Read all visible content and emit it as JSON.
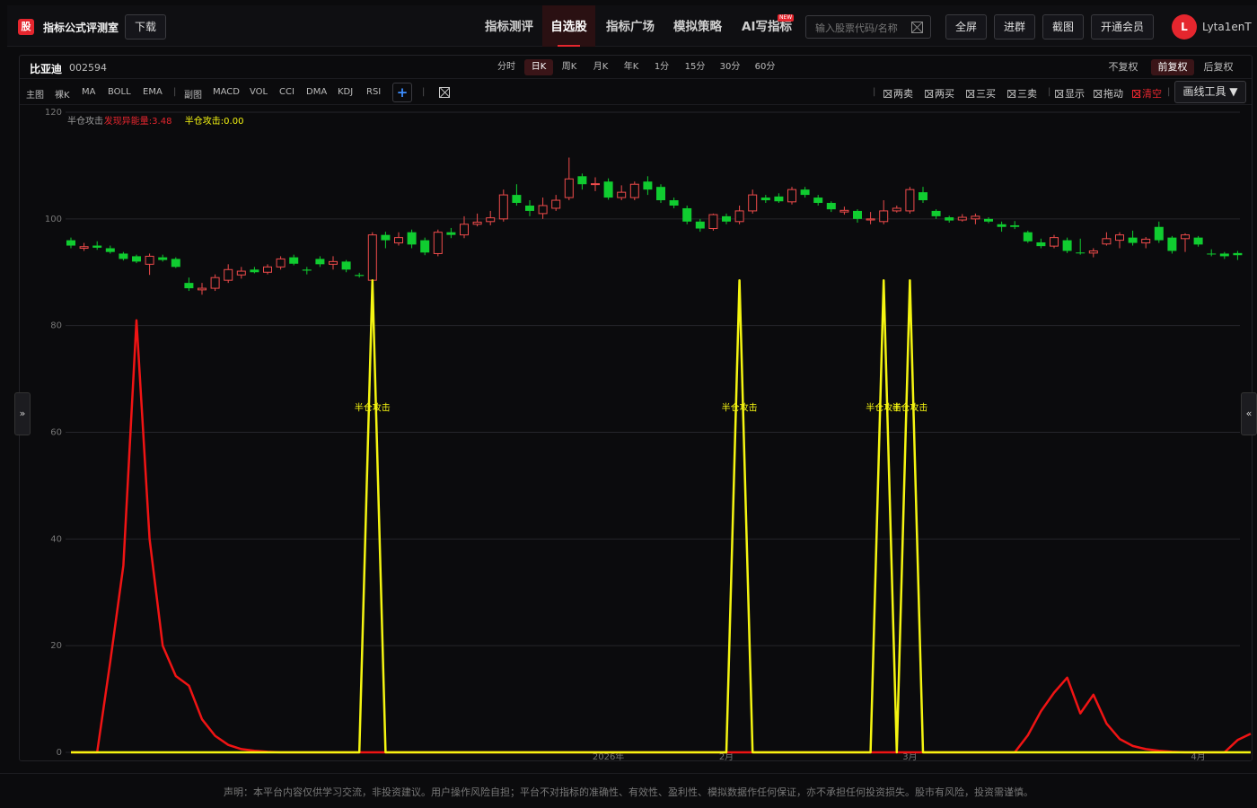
{
  "header": {
    "logo_text": "股",
    "brand": "指标公式评测室",
    "download": "下载",
    "nav": [
      "指标测评",
      "自选股",
      "指标广场",
      "模拟策略",
      "AI写指标"
    ],
    "nav_active": "自选股",
    "new_badge": "NEW",
    "search_placeholder": "输入股票代码/名称",
    "buttons": [
      "全屏",
      "进群",
      "截图",
      "开通会员"
    ],
    "avatar_letter": "L",
    "username": "Lyta1enT"
  },
  "stock": {
    "name": "比亚迪",
    "code": "002594"
  },
  "periods": [
    "分时",
    "日K",
    "周K",
    "月K",
    "年K",
    "1分",
    "15分",
    "30分",
    "60分"
  ],
  "period_active": "日K",
  "adjust": [
    "不复权",
    "前复权",
    "后复权"
  ],
  "adjust_active": "前复权",
  "main_indicators": [
    "主图",
    "裸K",
    "MA",
    "BOLL",
    "EMA"
  ],
  "sub_indicators": [
    "副图",
    "MACD",
    "VOL",
    "CCI",
    "DMA",
    "KDJ",
    "RSI"
  ],
  "add_label": "+",
  "tools": [
    "两卖",
    "两买",
    "三买",
    "三卖",
    "显示",
    "拖动",
    "清空"
  ],
  "draw_tool": "画线工具 ▼",
  "side_left": "»",
  "side_right": "«",
  "disclaimer": "声明：本平台内容仅供学习交流，非投资建议。用户操作风险自担；平台不对指标的准确性、有效性、盈利性、模拟数据作任何保证，亦不承担任何投资损失。股市有风险，投资需谨慎。",
  "chart_data": {
    "type": "candlestick",
    "y_ticks": [
      0,
      20,
      40,
      60,
      80,
      100,
      120
    ],
    "ylim": [
      0,
      120
    ],
    "x_labels": [
      "2026年",
      "2月",
      "3月",
      "4月"
    ],
    "legend": [
      {
        "text": "半仓攻击",
        "color": "#9a9a9a"
      },
      {
        "text": "发现异能量:3.48",
        "color": "#e5262e"
      },
      {
        "text": "半仓攻击:0.00",
        "color": "#f5f511"
      }
    ],
    "annotation_text": "半仓攻击",
    "colors": {
      "up": "#ef4b4b",
      "down": "#10cc30",
      "red_line": "#f01414",
      "yellow_line": "#f5f511"
    },
    "candles": [
      [
        96,
        95,
        96.5,
        94.5
      ],
      [
        94.5,
        94.8,
        95.5,
        94
      ],
      [
        95,
        94.6,
        95.8,
        94.2
      ],
      [
        94.5,
        93.8,
        95,
        93.5
      ],
      [
        93.5,
        92.5,
        93.8,
        92.2
      ],
      [
        93,
        92,
        93.3,
        91.7
      ],
      [
        91.5,
        93,
        93.5,
        89.5
      ],
      [
        92.8,
        92.3,
        93.3,
        92
      ],
      [
        92.5,
        91,
        92.8,
        90.8
      ],
      [
        88,
        87,
        89,
        86.5
      ],
      [
        86.7,
        87,
        88,
        85.8
      ],
      [
        87,
        89,
        89.6,
        86.5
      ],
      [
        88.5,
        90.5,
        91.5,
        88
      ],
      [
        89.5,
        90.2,
        91,
        88.8
      ],
      [
        90.5,
        90,
        91,
        89.8
      ],
      [
        90,
        91,
        91.5,
        89.6
      ],
      [
        91,
        92.5,
        93,
        90.5
      ],
      [
        92.8,
        91.6,
        93.3,
        91.3
      ],
      [
        90.5,
        90.3,
        91,
        89.6
      ],
      [
        92.5,
        91.5,
        93,
        91
      ],
      [
        91.5,
        92,
        93,
        90.5
      ],
      [
        92,
        90.5,
        92.3,
        90
      ],
      [
        89.5,
        89.3,
        89.9,
        89
      ],
      [
        88.5,
        97,
        97.5,
        88.3
      ],
      [
        97,
        96,
        97.6,
        94.5
      ],
      [
        95.5,
        96.5,
        97.5,
        95
      ],
      [
        97.5,
        95.2,
        98,
        94.5
      ],
      [
        96,
        93.7,
        96.5,
        93.2
      ],
      [
        93.5,
        97.5,
        98,
        93
      ],
      [
        97.5,
        97,
        98.3,
        96.4
      ],
      [
        97,
        99,
        100.5,
        96.4
      ],
      [
        99,
        99.4,
        101,
        98.6
      ],
      [
        99.5,
        100.2,
        101.5,
        98.8
      ],
      [
        100,
        104.5,
        105.5,
        99.5
      ],
      [
        104.5,
        103,
        106.5,
        102.5
      ],
      [
        102.5,
        101.5,
        103.5,
        100.5
      ],
      [
        101,
        102.5,
        104,
        100
      ],
      [
        102,
        103.5,
        104.5,
        101.5
      ],
      [
        104,
        107.5,
        111.5,
        103.5
      ],
      [
        108,
        106.5,
        108.5,
        105.5
      ],
      [
        106.5,
        106.6,
        107.8,
        105.2
      ],
      [
        107,
        104,
        107.6,
        103.6
      ],
      [
        104,
        105,
        106.3,
        103.5
      ],
      [
        104,
        106.5,
        107,
        103.5
      ],
      [
        107,
        105.5,
        108,
        104.5
      ],
      [
        106,
        103.5,
        106.5,
        103
      ],
      [
        103.5,
        102.5,
        104,
        102
      ],
      [
        102,
        99.5,
        102.5,
        99
      ],
      [
        99.5,
        98.2,
        100,
        97.6
      ],
      [
        98.2,
        100.8,
        101,
        97.8
      ],
      [
        100.5,
        99.5,
        101,
        99
      ],
      [
        99.5,
        101.5,
        102.5,
        99
      ],
      [
        101.5,
        104.5,
        105.5,
        101
      ],
      [
        104,
        103.5,
        104.5,
        103
      ],
      [
        104.2,
        103.3,
        104.8,
        103
      ],
      [
        103.2,
        105.5,
        106,
        102.7
      ],
      [
        105.5,
        104.5,
        106,
        104
      ],
      [
        104,
        103,
        104.5,
        102.5
      ],
      [
        103,
        101.8,
        103.3,
        101.3
      ],
      [
        101.3,
        101.6,
        102.3,
        100.8
      ],
      [
        101.5,
        100,
        101.8,
        99.3
      ],
      [
        99.8,
        100,
        101.3,
        99
      ],
      [
        99.5,
        101.5,
        103.5,
        99
      ],
      [
        101.5,
        102,
        102.5,
        101.2
      ],
      [
        101.5,
        105.5,
        106,
        101
      ],
      [
        105,
        103.5,
        106,
        103
      ],
      [
        101.5,
        100.5,
        101.8,
        100
      ],
      [
        100.3,
        99.7,
        100.6,
        99.3
      ],
      [
        99.8,
        100.3,
        100.9,
        99.5
      ],
      [
        100,
        100.5,
        101,
        99
      ],
      [
        100,
        99.5,
        100.3,
        99.2
      ],
      [
        99,
        98.5,
        99.5,
        97.6
      ],
      [
        98.8,
        98.5,
        99.6,
        98.1
      ],
      [
        97.5,
        95.8,
        97.8,
        95.5
      ],
      [
        95.6,
        94.9,
        96.3,
        94.5
      ],
      [
        94.9,
        96.5,
        97,
        94.5
      ],
      [
        96,
        94,
        96.5,
        93.6
      ],
      [
        93.7,
        93.6,
        96.3,
        93.3
      ],
      [
        93.6,
        94,
        94.5,
        92.8
      ],
      [
        95.3,
        96.3,
        97.5,
        95
      ],
      [
        96,
        97,
        97.5,
        94.5
      ],
      [
        96.5,
        95.5,
        97.8,
        95
      ],
      [
        95.5,
        96.2,
        96.6,
        94.5
      ],
      [
        98.5,
        96,
        99.5,
        95.5
      ],
      [
        96.5,
        94,
        96.8,
        93.5
      ],
      [
        96.3,
        97,
        97.3,
        93.8
      ],
      [
        96.5,
        95.2,
        96.8,
        94.8
      ],
      [
        93.5,
        93.4,
        94.3,
        93
      ],
      [
        93.5,
        93,
        93.8,
        92.5
      ],
      [
        93.6,
        93.2,
        94,
        92.3
      ]
    ],
    "red_line": [
      [
        0,
        0
      ],
      [
        2,
        0
      ],
      [
        3,
        17
      ],
      [
        4,
        35
      ],
      [
        5,
        81
      ],
      [
        6,
        40
      ],
      [
        7,
        20
      ],
      [
        8,
        14.3
      ],
      [
        9,
        12.5
      ],
      [
        10,
        6.2
      ],
      [
        11,
        3.1
      ],
      [
        12,
        1.4
      ],
      [
        13,
        0.6
      ],
      [
        14,
        0.3
      ],
      [
        15,
        0.1
      ],
      [
        16,
        0
      ],
      [
        72,
        0
      ],
      [
        73,
        3.2
      ],
      [
        74,
        7.7
      ],
      [
        75,
        11.2
      ],
      [
        76,
        14
      ],
      [
        77,
        7.3
      ],
      [
        78,
        10.8
      ],
      [
        79,
        5.4
      ],
      [
        80,
        2.5
      ],
      [
        81,
        1.2
      ],
      [
        82,
        0.6
      ],
      [
        83,
        0.3
      ],
      [
        84,
        0.1
      ],
      [
        85,
        0
      ],
      [
        88,
        0
      ],
      [
        89,
        2.3
      ],
      [
        90,
        3.48
      ]
    ],
    "yellow_line": [
      [
        0,
        0
      ],
      [
        22,
        0
      ],
      [
        23,
        88.5
      ],
      [
        24,
        0
      ],
      [
        50,
        0
      ],
      [
        51,
        88.5
      ],
      [
        52,
        0
      ],
      [
        61,
        0
      ],
      [
        62,
        88.5
      ],
      [
        63,
        0
      ],
      [
        64,
        88.5
      ],
      [
        65,
        0
      ],
      [
        90,
        0
      ]
    ]
  }
}
